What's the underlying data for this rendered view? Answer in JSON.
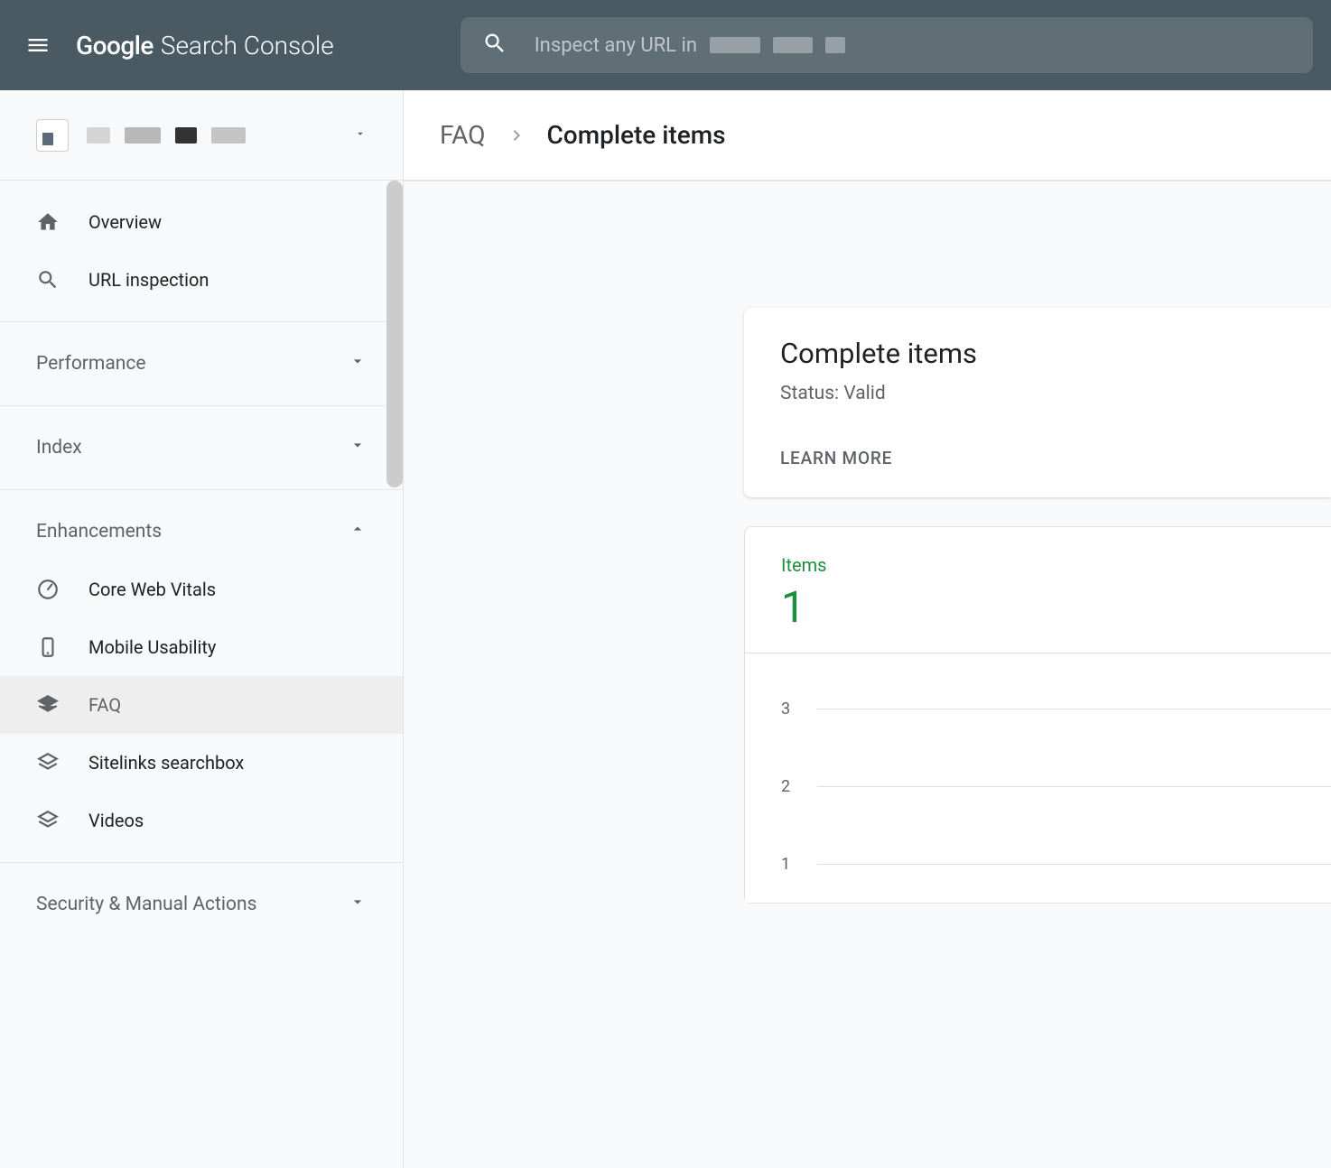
{
  "topbar": {
    "logo_google": "Google",
    "logo_product": "Search Console",
    "search_placeholder": "Inspect any URL in"
  },
  "sidebar": {
    "items": {
      "overview": "Overview",
      "url_inspection": "URL inspection",
      "core_web_vitals": "Core Web Vitals",
      "mobile_usability": "Mobile Usability",
      "faq": "FAQ",
      "sitelinks_searchbox": "Sitelinks searchbox",
      "videos": "Videos"
    },
    "sections": {
      "performance": "Performance",
      "index": "Index",
      "enhancements": "Enhancements",
      "security": "Security & Manual Actions"
    }
  },
  "breadcrumb": {
    "parent": "FAQ",
    "current": "Complete items"
  },
  "status_card": {
    "title": "Complete items",
    "status": "Status: Valid",
    "learn_more": "LEARN MORE"
  },
  "items_card": {
    "label": "Items",
    "count": "1"
  },
  "chart_data": {
    "type": "line",
    "title": "Items",
    "ylabel": "",
    "ylim": [
      0,
      3
    ],
    "y_ticks": [
      "3",
      "2",
      "1"
    ],
    "series": [
      {
        "name": "Items",
        "values": [
          1
        ]
      }
    ]
  }
}
